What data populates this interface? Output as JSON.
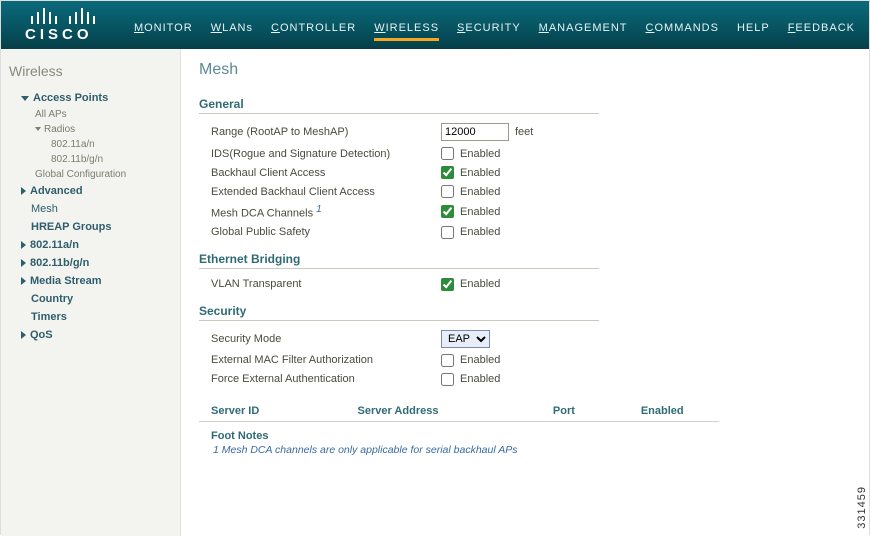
{
  "header": {
    "brand": "CISCO",
    "nav": [
      {
        "key": "monitor",
        "l": "M",
        "r": "ONITOR"
      },
      {
        "key": "wlans",
        "l": "W",
        "r": "LANs"
      },
      {
        "key": "controller",
        "l": "C",
        "r": "ONTROLLER"
      },
      {
        "key": "wireless",
        "l": "W",
        "r": "IRELESS",
        "active": true
      },
      {
        "key": "security",
        "l": "S",
        "r": "ECURITY"
      },
      {
        "key": "management",
        "l": "M",
        "r": "ANAGEMENT"
      },
      {
        "key": "commands",
        "l": "C",
        "r": "OMMANDS"
      },
      {
        "key": "help",
        "label": "HELP"
      },
      {
        "key": "feedback",
        "l": "F",
        "r": "EEDBACK"
      }
    ]
  },
  "sidebar": {
    "title": "Wireless",
    "ap_label": "Access Points",
    "all_aps": "All APs",
    "radios": "Radios",
    "r80211an": "802.11a/n",
    "r80211bgn": "802.11b/g/n",
    "global_cfg": "Global Configuration",
    "advanced": "Advanced",
    "mesh": "Mesh",
    "hreap": "HREAP Groups",
    "s80211an": "802.11a/n",
    "s80211bgn": "802.11b/g/n",
    "media": "Media Stream",
    "country": "Country",
    "timers": "Timers",
    "qos": "QoS"
  },
  "page": {
    "title": "Mesh",
    "general": {
      "heading": "General",
      "range_label": "Range (RootAP to MeshAP)",
      "range_value": "12000",
      "range_unit": "feet",
      "ids_label": "IDS(Rogue and Signature Detection)",
      "enabled_text": "Enabled",
      "ids_checked": false,
      "backhaul_label": "Backhaul Client Access",
      "backhaul_checked": true,
      "ext_backhaul_label": "Extended Backhaul Client Access",
      "ext_backhaul_checked": false,
      "dca_label": "Mesh DCA Channels",
      "dca_fn": "1",
      "dca_checked": true,
      "gps_label": "Global Public Safety",
      "gps_checked": false
    },
    "eth": {
      "heading": "Ethernet Bridging",
      "vlan_label": "VLAN Transparent",
      "vlan_checked": true
    },
    "security": {
      "heading": "Security",
      "mode_label": "Security Mode",
      "mode_value": "EAP",
      "ext_mac_label": "External MAC Filter Authorization",
      "ext_mac_checked": false,
      "force_label": "Force External Authentication",
      "force_checked": false
    },
    "servers": {
      "id": "Server ID",
      "addr": "Server Address",
      "port": "Port",
      "enabled": "Enabled"
    },
    "footnotes": {
      "heading": "Foot Notes",
      "n1": "1 Mesh DCA channels are only applicable for serial backhaul APs"
    }
  },
  "figure_number": "331459"
}
